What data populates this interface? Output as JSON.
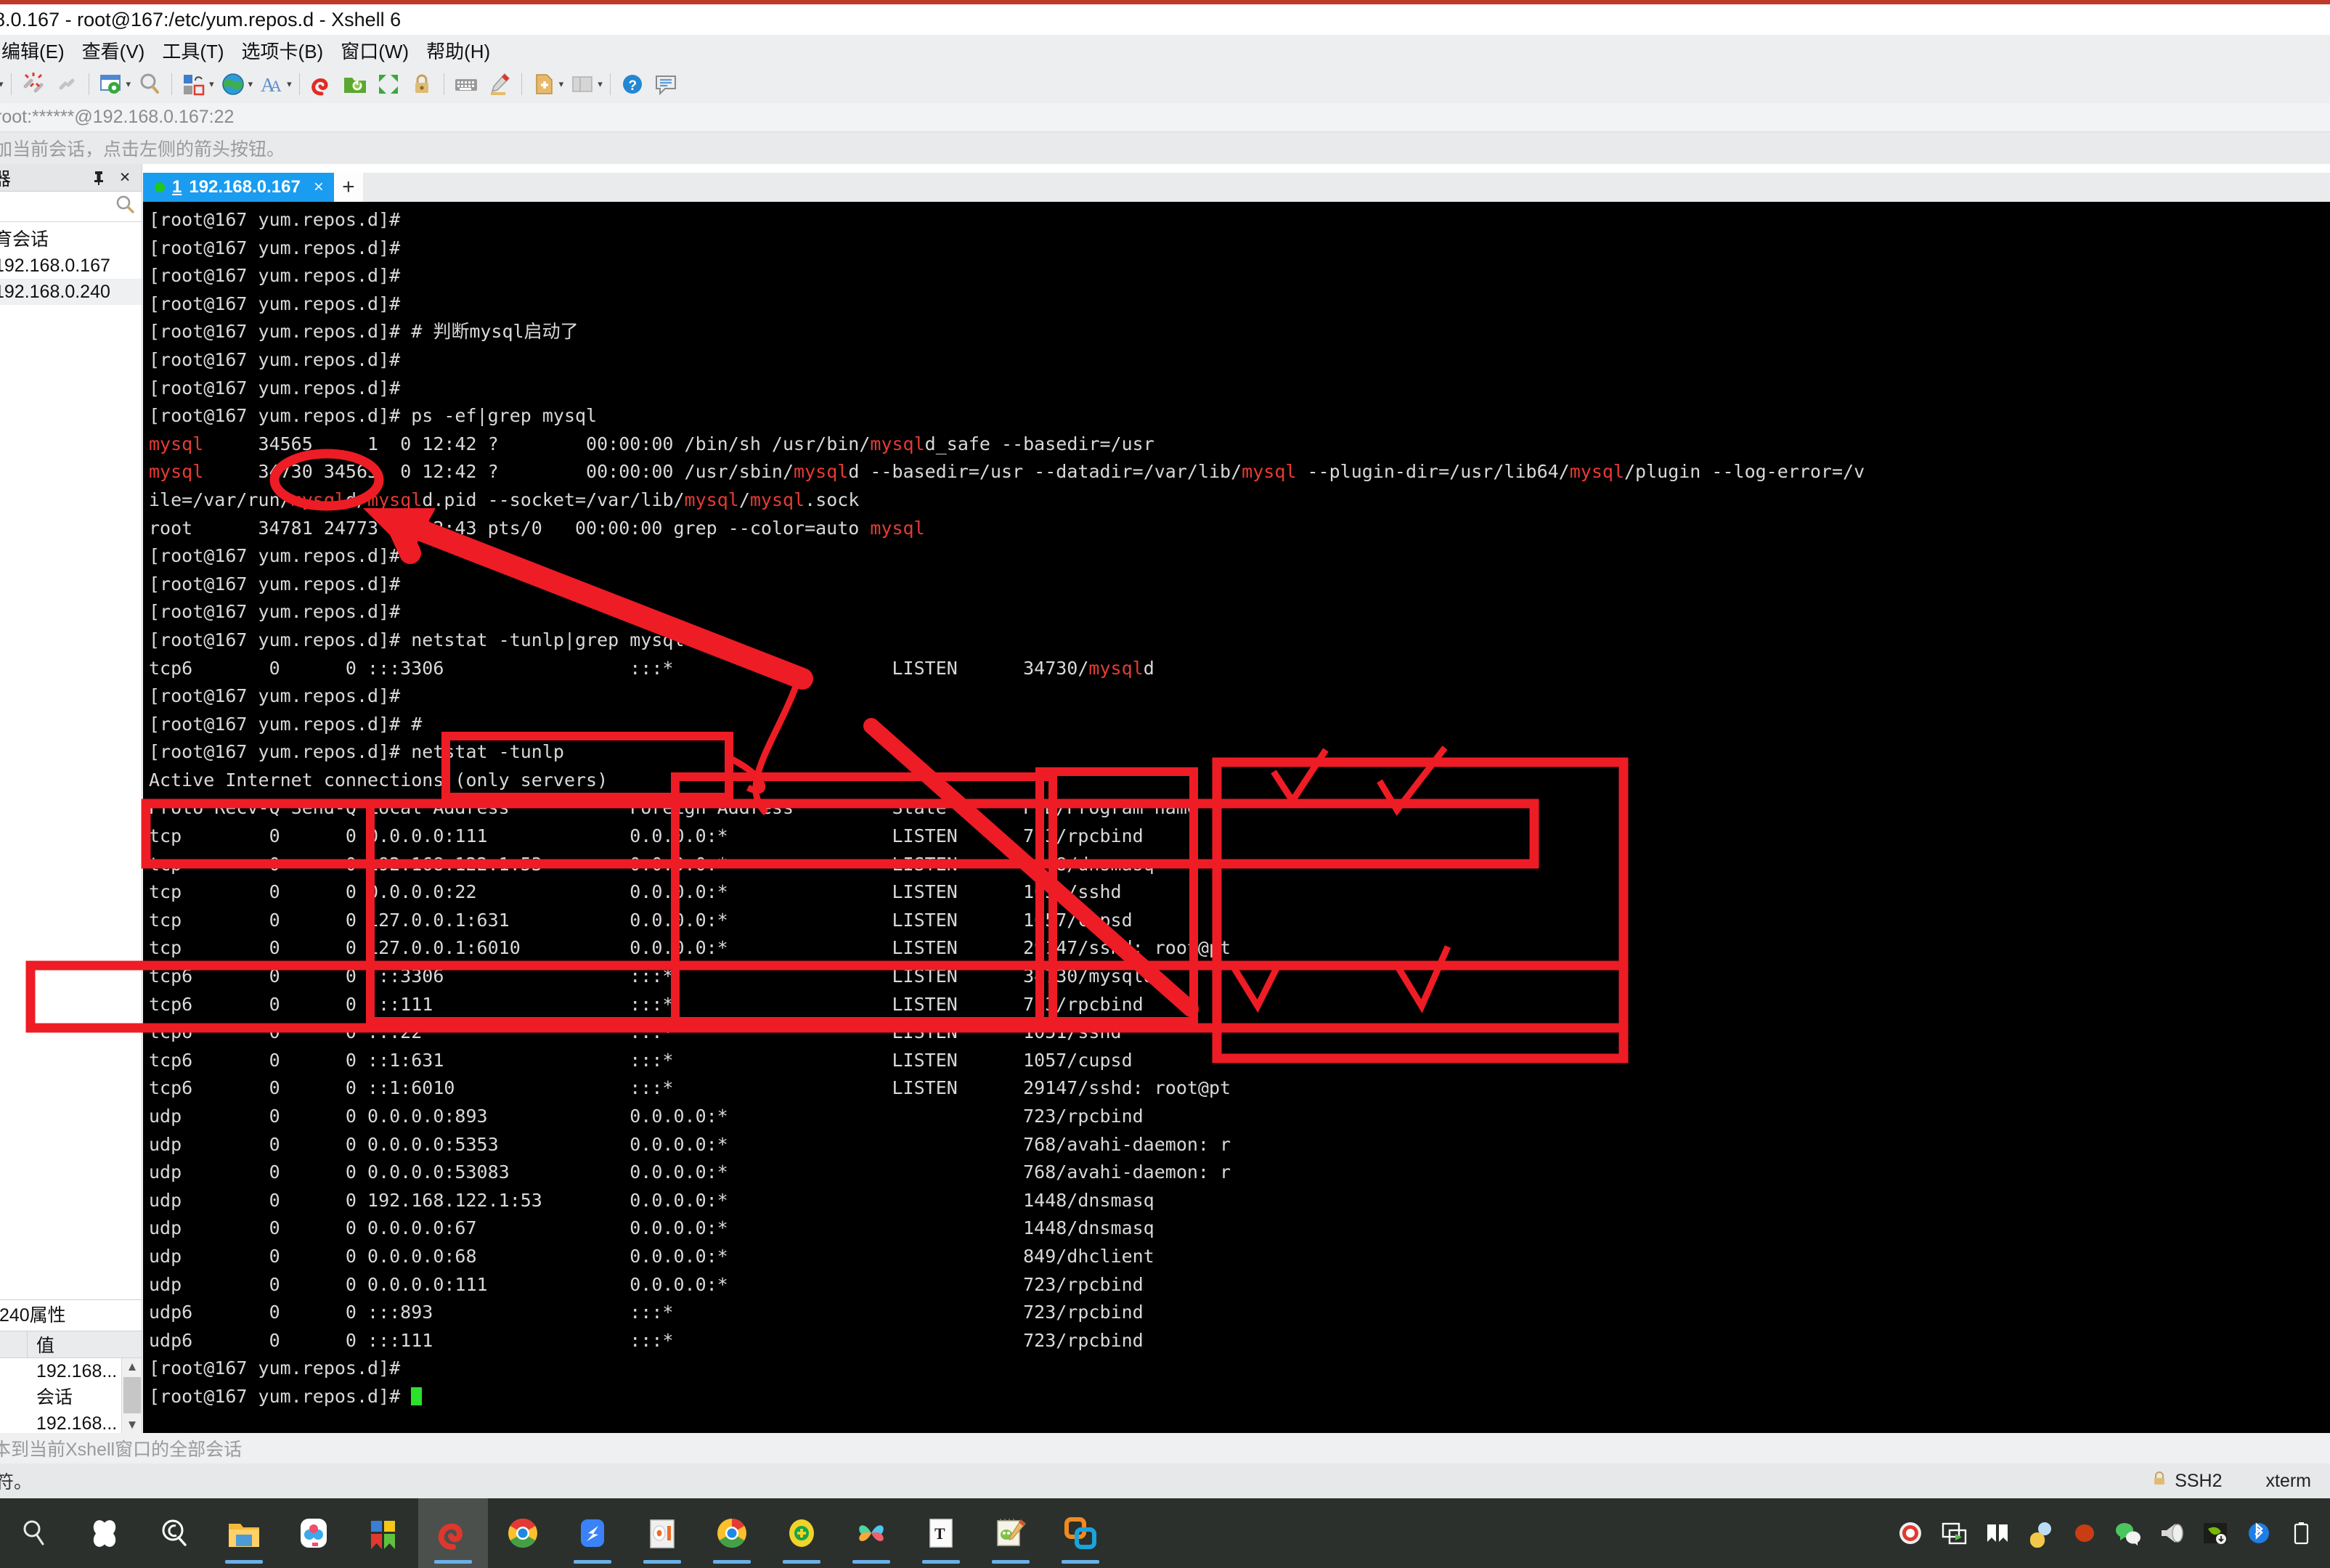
{
  "window": {
    "title": "8.0.167 - root@167:/etc/yum.repos.d - Xshell 6"
  },
  "menu": {
    "items": [
      "编辑(E)",
      "查看(V)",
      "工具(T)",
      "选项卡(B)",
      "窗口(W)",
      "帮助(H)"
    ]
  },
  "toolbar": {
    "icons": [
      "disconnect-icon",
      "link-icon",
      "properties-icon",
      "find-icon",
      "transfer-icon",
      "globe-icon",
      "font-icon",
      "spiral-icon",
      "folder-run-icon",
      "fullscreen-icon",
      "lock-icon",
      "keyboard-icon",
      "highlight-icon",
      "new-file-icon",
      "layout-icon",
      "help-icon",
      "comment-icon"
    ]
  },
  "address": {
    "value": "root:******@192.168.0.167:22"
  },
  "hint": {
    "text": "加当前会话，点击左侧的箭头按钮。"
  },
  "sidebar": {
    "title": "器",
    "pin_icon": "pin-icon",
    "close_icon": "close-icon",
    "search_icon": "search-icon",
    "items": [
      {
        "label": "育会话",
        "selected": false
      },
      {
        "label": "192.168.0.167",
        "selected": false
      },
      {
        "label": "192.168.0.240",
        "selected": true
      }
    ]
  },
  "properties": {
    "title": ".240属性",
    "columns": [
      "",
      "值"
    ],
    "rows": [
      "192.168...",
      "会话",
      "192.168..."
    ],
    "scroll_up_icon": "chevron-up-icon",
    "scroll_down_icon": "chevron-down-icon"
  },
  "tabs": {
    "active": {
      "number": "1",
      "label": "192.168.0.167",
      "close_label": "×",
      "status_dot": "green"
    },
    "add_label": "+"
  },
  "terminal": {
    "prompt": "[root@167 yum.repos.d]#",
    "lines": [
      [
        {
          "t": "[root@167 yum.repos.d]#",
          "c": "w"
        }
      ],
      [
        {
          "t": "[root@167 yum.repos.d]#",
          "c": "w"
        }
      ],
      [
        {
          "t": "[root@167 yum.repos.d]#",
          "c": "w"
        }
      ],
      [
        {
          "t": "[root@167 yum.repos.d]#",
          "c": "w"
        }
      ],
      [
        {
          "t": "[root@167 yum.repos.d]# # 判断mysql启动了",
          "c": "w"
        }
      ],
      [
        {
          "t": "[root@167 yum.repos.d]#",
          "c": "w"
        }
      ],
      [
        {
          "t": "[root@167 yum.repos.d]#",
          "c": "w"
        }
      ],
      [
        {
          "t": "[root@167 yum.repos.d]# ps -ef|grep mysql",
          "c": "w"
        }
      ],
      [
        {
          "t": "mysql",
          "c": "r"
        },
        {
          "t": "     34565     1  0 12:42 ?        00:00:00 /bin/sh /usr/bin/",
          "c": "w"
        },
        {
          "t": "mysql",
          "c": "r"
        },
        {
          "t": "d_safe --basedir=/usr",
          "c": "w"
        }
      ],
      [
        {
          "t": "mysql",
          "c": "r"
        },
        {
          "t": "     34730 34565  0 12:42 ?        00:00:00 /usr/sbin/",
          "c": "w"
        },
        {
          "t": "mysql",
          "c": "r"
        },
        {
          "t": "d --basedir=/usr --datadir=/var/lib/",
          "c": "w"
        },
        {
          "t": "mysql",
          "c": "r"
        },
        {
          "t": " --plugin-dir=/usr/lib64/",
          "c": "w"
        },
        {
          "t": "mysql",
          "c": "r"
        },
        {
          "t": "/plugin --log-error=/v",
          "c": "w"
        }
      ],
      [
        {
          "t": "ile=/var/run/",
          "c": "w"
        },
        {
          "t": "mysql",
          "c": "r"
        },
        {
          "t": "d/",
          "c": "w"
        },
        {
          "t": "mysql",
          "c": "r"
        },
        {
          "t": "d.pid --socket=/var/lib/",
          "c": "w"
        },
        {
          "t": "mysql",
          "c": "r"
        },
        {
          "t": "/",
          "c": "w"
        },
        {
          "t": "mysql",
          "c": "r"
        },
        {
          "t": ".sock",
          "c": "w"
        }
      ],
      [
        {
          "t": "root      34781 24773  0 12:43 pts/0   00:00:00 grep --color=auto ",
          "c": "w"
        },
        {
          "t": "mysql",
          "c": "r"
        }
      ],
      [
        {
          "t": "[root@167 yum.repos.d]#",
          "c": "w"
        }
      ],
      [
        {
          "t": "[root@167 yum.repos.d]#",
          "c": "w"
        }
      ],
      [
        {
          "t": "[root@167 yum.repos.d]#",
          "c": "w"
        }
      ],
      [
        {
          "t": "[root@167 yum.repos.d]# netstat -tunlp|grep mysql",
          "c": "w"
        }
      ],
      [
        {
          "t": "tcp6       0      0 :::3306                 :::*                    LISTEN      34730/",
          "c": "w"
        },
        {
          "t": "mysql",
          "c": "r"
        },
        {
          "t": "d",
          "c": "w"
        }
      ],
      [
        {
          "t": "[root@167 yum.repos.d]#",
          "c": "w"
        }
      ],
      [
        {
          "t": "[root@167 yum.repos.d]# #",
          "c": "w"
        }
      ],
      [
        {
          "t": "[root@167 yum.repos.d]# netstat -tunlp",
          "c": "w"
        }
      ],
      [
        {
          "t": "Active Internet connections (only servers)",
          "c": "w"
        }
      ],
      [
        {
          "t": "Proto Recv-Q Send-Q Local Address           Foreign Address         State       PID/Program name",
          "c": "w"
        }
      ],
      [
        {
          "t": "tcp        0      0 0.0.0.0:111             0.0.0.0:*               LISTEN      723/rpcbind",
          "c": "w"
        }
      ],
      [
        {
          "t": "tcp        0      0 192.168.122.1:53        0.0.0.0:*               LISTEN      1448/dnsmasq",
          "c": "w"
        }
      ],
      [
        {
          "t": "tcp        0      0 0.0.0.0:22              0.0.0.0:*               LISTEN      1051/sshd",
          "c": "w"
        }
      ],
      [
        {
          "t": "tcp        0      0 127.0.0.1:631           0.0.0.0:*               LISTEN      1057/cupsd",
          "c": "w"
        }
      ],
      [
        {
          "t": "tcp        0      0 127.0.0.1:6010          0.0.0.0:*               LISTEN      29147/sshd: root@pt",
          "c": "w"
        }
      ],
      [
        {
          "t": "tcp6       0      0 :::3306                 :::*                    LISTEN      34730/mysqld",
          "c": "w"
        }
      ],
      [
        {
          "t": "tcp6       0      0 :::111                  :::*                    LISTEN      723/rpcbind",
          "c": "w"
        }
      ],
      [
        {
          "t": "tcp6       0      0 :::22                   :::*                    LISTEN      1051/sshd",
          "c": "w"
        }
      ],
      [
        {
          "t": "tcp6       0      0 ::1:631                 :::*                    LISTEN      1057/cupsd",
          "c": "w"
        }
      ],
      [
        {
          "t": "tcp6       0      0 ::1:6010                :::*                    LISTEN      29147/sshd: root@pt",
          "c": "w"
        }
      ],
      [
        {
          "t": "udp        0      0 0.0.0.0:893             0.0.0.0:*                           723/rpcbind",
          "c": "w"
        }
      ],
      [
        {
          "t": "udp        0      0 0.0.0.0:5353            0.0.0.0:*                           768/avahi-daemon: r",
          "c": "w"
        }
      ],
      [
        {
          "t": "udp        0      0 0.0.0.0:53083           0.0.0.0:*                           768/avahi-daemon: r",
          "c": "w"
        }
      ],
      [
        {
          "t": "udp        0      0 192.168.122.1:53        0.0.0.0:*                           1448/dnsmasq",
          "c": "w"
        }
      ],
      [
        {
          "t": "udp        0      0 0.0.0.0:67              0.0.0.0:*                           1448/dnsmasq",
          "c": "w"
        }
      ],
      [
        {
          "t": "udp        0      0 0.0.0.0:68              0.0.0.0:*                           849/dhclient",
          "c": "w"
        }
      ],
      [
        {
          "t": "udp        0      0 0.0.0.0:111             0.0.0.0:*                           723/rpcbind",
          "c": "w"
        }
      ],
      [
        {
          "t": "udp6       0      0 :::893                  :::*                                723/rpcbind",
          "c": "w"
        }
      ],
      [
        {
          "t": "udp6       0      0 :::111                  :::*                                723/rpcbind",
          "c": "w"
        }
      ],
      [
        {
          "t": "[root@167 yum.repos.d]#",
          "c": "w"
        }
      ]
    ],
    "last_prompt": "[root@167 yum.repos.d]# ",
    "colors": {
      "background": "#000000",
      "foreground": "#d9d9d9",
      "highlight": "#e63b32",
      "cursor": "#2de02d"
    }
  },
  "annotations": {
    "color": "#ee1c25",
    "circled_pid": "34730",
    "highlight_boxes": [
      "netstat-tunlp-command-box",
      "header-row-box",
      "local-address-column-box",
      "foreign-address-column-box",
      "state-column-box",
      "pid-program-column-box",
      "tcp6-3306-row-box"
    ],
    "arrow": "pid-to-listening-port-arrow",
    "checkmarks": 2
  },
  "footer_hint": {
    "text": "本到当前Xshell窗口的全部会话"
  },
  "statusbar": {
    "left_text": "符。",
    "lock_icon": "lock-icon",
    "protocol": "SSH2",
    "terminal_type": "xterm"
  },
  "taskbar": {
    "items": [
      "search-icon",
      "cortana-icon",
      "magnifier-icon",
      "file-explorer-icon",
      "baidu-netdisk-icon",
      "wps-office-icon",
      "xshell-icon",
      "chrome-icon",
      "dove-icon",
      "media-icon",
      "chrome2-icon",
      "eset-icon",
      "butterfly-icon",
      "typora-icon",
      "notepad-icon",
      "vmware-icon"
    ],
    "active_index": 6,
    "tray": [
      "record-icon",
      "screencast-icon",
      "wps-tray-icon",
      "qq-icon",
      "red-dot-icon",
      "wechat-icon",
      "speaker-icon",
      "nvidia-icon",
      "bluetooth-icon",
      "battery-icon"
    ]
  }
}
